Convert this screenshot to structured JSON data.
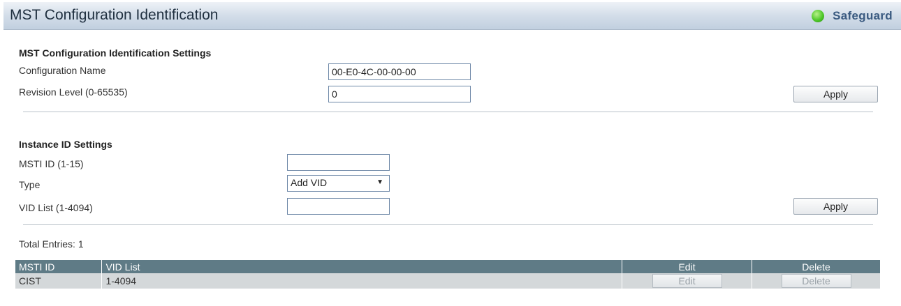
{
  "header": {
    "title": "MST Configuration Identification",
    "safeguard": "Safeguard"
  },
  "mst_settings": {
    "section_title": "MST Configuration Identification Settings",
    "config_name_label": "Configuration Name",
    "config_name_value": "00-E0-4C-00-00-00",
    "revision_label": "Revision Level (0-65535)",
    "revision_value": "0",
    "apply_label": "Apply"
  },
  "instance_settings": {
    "section_title": "Instance ID Settings",
    "msti_label": "MSTI ID (1-15)",
    "msti_value": "",
    "type_label": "Type",
    "type_selected": "Add VID",
    "vid_label": "VID List (1-4094)",
    "vid_value": "",
    "apply_label": "Apply"
  },
  "entries": {
    "total_label": "Total Entries: 1",
    "columns": [
      "MSTI ID",
      "VID List",
      "Edit",
      "Delete"
    ],
    "rows": [
      {
        "msti_id": "CIST",
        "vid_list": "1-4094",
        "edit_label": "Edit",
        "delete_label": "Delete"
      }
    ]
  }
}
